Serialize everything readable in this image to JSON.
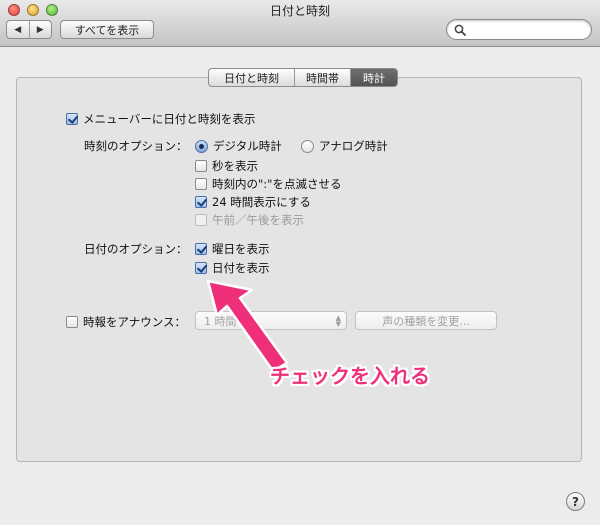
{
  "window": {
    "title": "日付と時刻"
  },
  "toolbar": {
    "back": "◀",
    "forward": "▶",
    "show_all": "すべてを表示",
    "search_placeholder": ""
  },
  "tabs": [
    {
      "label": "日付と時刻",
      "active": false
    },
    {
      "label": "時間帯",
      "active": false
    },
    {
      "label": "時計",
      "active": true
    }
  ],
  "clock": {
    "show_in_menubar": {
      "label": "メニューバーに日付と時刻を表示",
      "checked": true
    },
    "time_options_label": "時刻のオプション：",
    "digital": {
      "label": "デジタル時計",
      "selected": true
    },
    "analog": {
      "label": "アナログ時計",
      "selected": false
    },
    "show_seconds": {
      "label": "秒を表示",
      "checked": false
    },
    "flash_separators": {
      "label": "時刻内の\":\"を点滅させる",
      "checked": false
    },
    "use_24h": {
      "label": "24 時間表示にする",
      "checked": true
    },
    "show_ampm": {
      "label": "午前／午後を表示",
      "checked": false,
      "disabled": true
    },
    "date_options_label": "日付のオプション：",
    "show_weekday": {
      "label": "曜日を表示",
      "checked": true
    },
    "show_date": {
      "label": "日付を表示",
      "checked": true
    },
    "announce": {
      "label": "時報をアナウンス：",
      "checked": false
    },
    "interval_value": "1 時間",
    "voice_button": "声の種類を変更..."
  },
  "help_label": "?",
  "annotation": {
    "text": "チェックを入れる",
    "color": "#ef2f7a"
  }
}
